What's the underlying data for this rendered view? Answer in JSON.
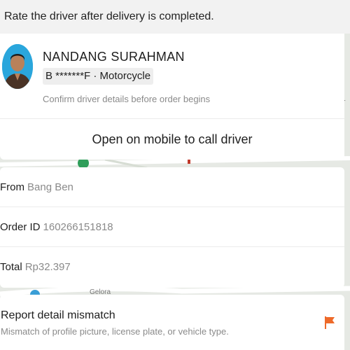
{
  "banner": {
    "text": "Rate the driver after delivery is completed."
  },
  "driver": {
    "name": "NANDANG SURAHMAN",
    "vehicle": "B *******F · Motorcycle",
    "confirm_note": "Confirm driver details before order begins",
    "call_label": "Open on mobile to call driver"
  },
  "order": {
    "rows": [
      {
        "label": "From",
        "value": "Bang Ben"
      },
      {
        "label": "Order ID",
        "value": "160266151818"
      },
      {
        "label": "Total",
        "value": "Rp32.397"
      }
    ]
  },
  "report": {
    "title": "Report detail mismatch",
    "subtitle": "Mismatch of profile picture, license plate, or vehicle type."
  },
  "map": {
    "road_label": "Gelora",
    "edge_char": "r"
  },
  "colors": {
    "accent": "#ee6a2a",
    "muted_text": "#8a8a8a",
    "map_bg": "#e6e9e4",
    "map_pin": "#2f9e5a"
  },
  "icons": {
    "report": "flag-icon",
    "avatar": "driver-photo"
  }
}
